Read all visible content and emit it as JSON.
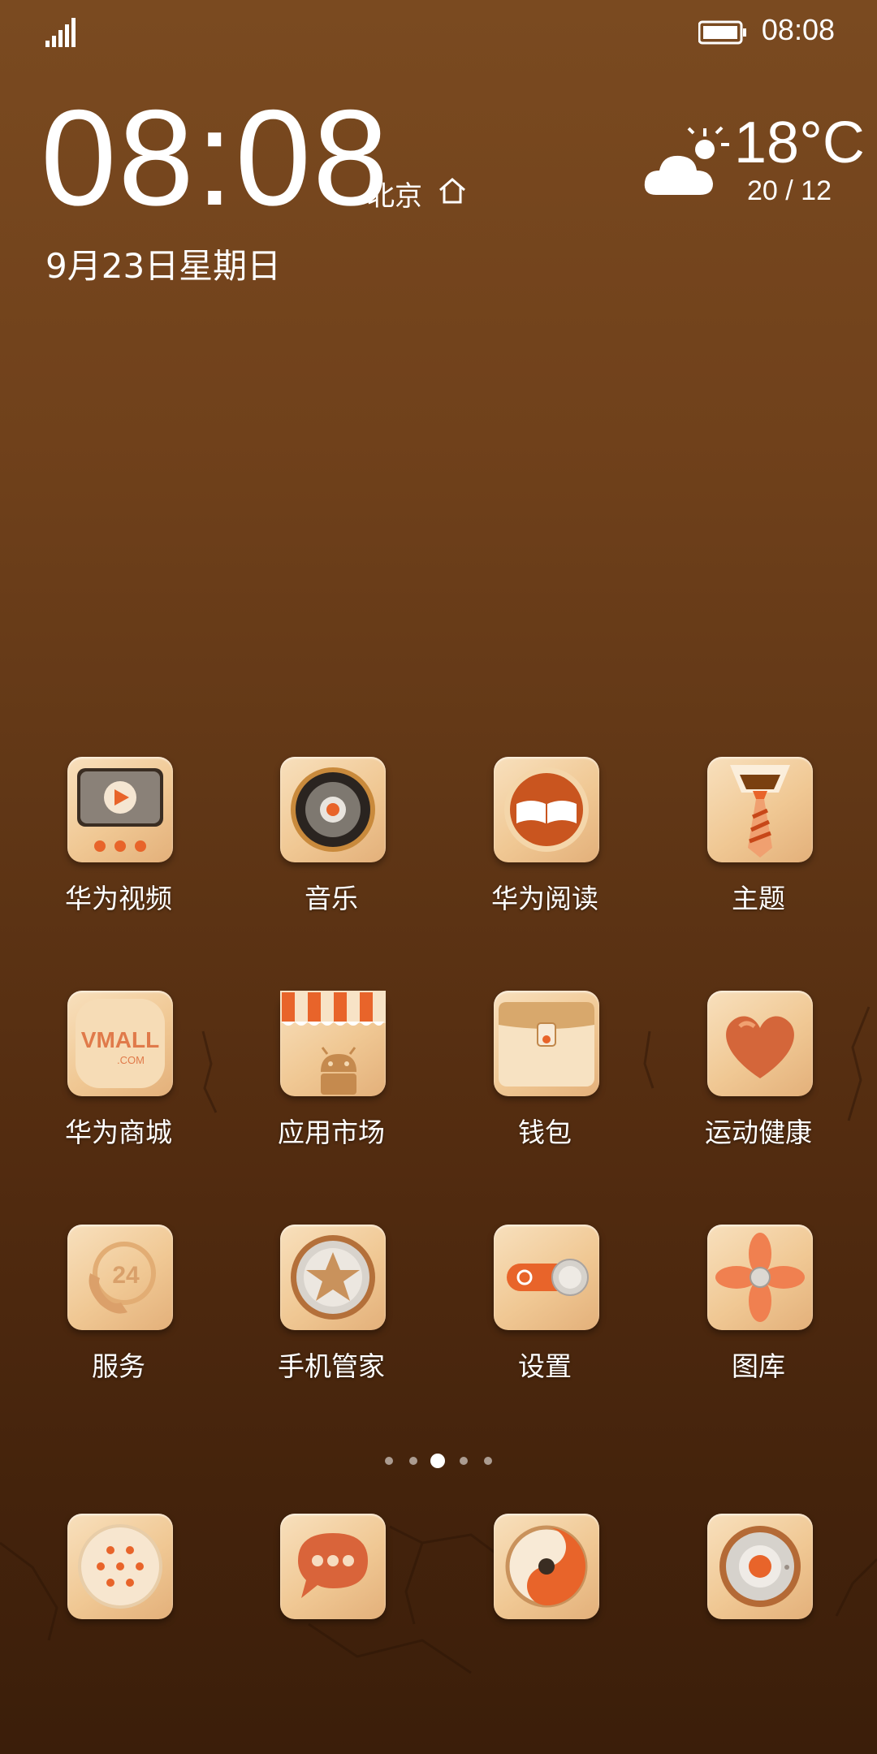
{
  "status_bar": {
    "time": "08:08"
  },
  "clock": {
    "time": "08:08",
    "city": "北京",
    "date": "9月23日星期日"
  },
  "weather": {
    "temp": "18°C",
    "range": "20 / 12"
  },
  "apps": [
    {
      "label": "华为视频",
      "icon": "video-icon"
    },
    {
      "label": "音乐",
      "icon": "music-icon"
    },
    {
      "label": "华为阅读",
      "icon": "book-icon"
    },
    {
      "label": "主题",
      "icon": "theme-icon"
    },
    {
      "label": "华为商城",
      "icon": "vmall-icon"
    },
    {
      "label": "应用市场",
      "icon": "appstore-icon"
    },
    {
      "label": "钱包",
      "icon": "wallet-icon"
    },
    {
      "label": "运动健康",
      "icon": "heart-icon"
    },
    {
      "label": "服务",
      "icon": "service-icon"
    },
    {
      "label": "手机管家",
      "icon": "phone-manager-icon"
    },
    {
      "label": "设置",
      "icon": "settings-icon"
    },
    {
      "label": "图库",
      "icon": "gallery-icon"
    }
  ],
  "vmall_text": {
    "brand": "VMALL",
    "domain": ".COM"
  },
  "service_number": "24",
  "page_indicator": {
    "count": 5,
    "active": 3
  },
  "dock": [
    {
      "icon": "dialer-icon"
    },
    {
      "icon": "messages-icon"
    },
    {
      "icon": "browser-icon"
    },
    {
      "icon": "camera-icon"
    }
  ],
  "colors": {
    "accent": "#e8642a",
    "tile": "#f0c894"
  }
}
